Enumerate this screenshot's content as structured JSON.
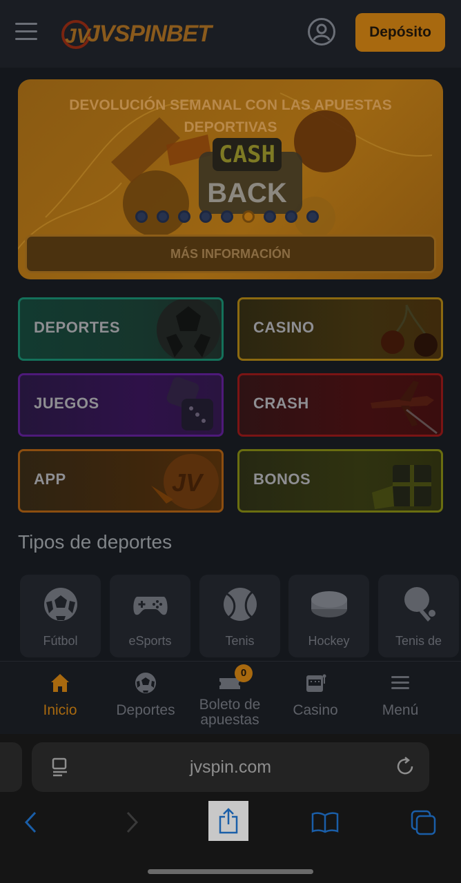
{
  "header": {
    "logo_text": "JVSPINBET",
    "deposit_label": "Depósito"
  },
  "banner": {
    "title": "DEVOLUCIÓN SEMANAL CON LAS APUESTAS DEPORTIVAS",
    "art_top": "CASH",
    "art_bottom": "BACK",
    "more_label": "MÁS INFORMACIÓN",
    "slides": 9,
    "active_slide": 6
  },
  "categories": [
    {
      "label": "DEPORTES"
    },
    {
      "label": "CASINO"
    },
    {
      "label": "JUEGOS"
    },
    {
      "label": "CRASH"
    },
    {
      "label": "APP"
    },
    {
      "label": "BONOS"
    }
  ],
  "sports_section": {
    "title": "Tipos de deportes",
    "items": [
      {
        "label": "Fútbol"
      },
      {
        "label": "eSports"
      },
      {
        "label": "Tenis"
      },
      {
        "label": "Hockey"
      },
      {
        "label": "Tenis de"
      }
    ]
  },
  "bottom_nav": {
    "items": [
      {
        "label": "Inicio"
      },
      {
        "label": "Deportes"
      },
      {
        "label": "Boleto de apuestas"
      },
      {
        "label": "Casino"
      },
      {
        "label": "Menú"
      }
    ],
    "betslip_count": "0",
    "active_color": "#a8690f"
  },
  "browser": {
    "url": "jvspin.com"
  }
}
